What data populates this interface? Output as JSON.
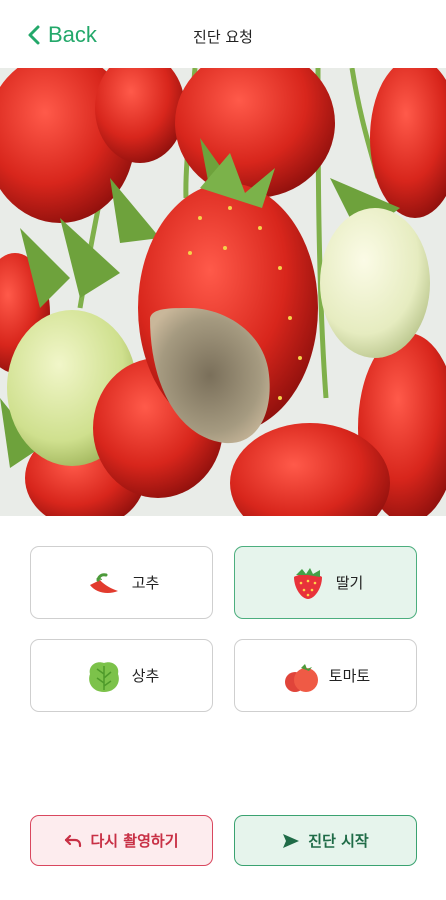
{
  "header": {
    "back_label": "Back",
    "title": "진단 요청"
  },
  "crops": [
    {
      "label": "고추",
      "icon": "chili-pepper-icon",
      "selected": false
    },
    {
      "label": "딸기",
      "icon": "strawberry-icon",
      "selected": true
    },
    {
      "label": "상추",
      "icon": "lettuce-icon",
      "selected": false
    },
    {
      "label": "토마토",
      "icon": "tomato-icon",
      "selected": false
    }
  ],
  "actions": {
    "retake_label": "다시 촬영하기",
    "start_label": "진단 시작"
  },
  "colors": {
    "accent": "#23a86a",
    "selected_bg": "#e6f4ec",
    "retake_border": "#d9475e"
  }
}
